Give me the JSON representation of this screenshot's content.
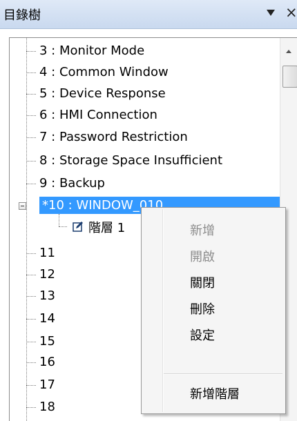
{
  "panel": {
    "title": "目錄樹",
    "pin_icon": "dropdown-arrow-icon",
    "close_icon": "close-icon",
    "close_glyph": "×"
  },
  "tree": {
    "items": [
      {
        "label": "3 : Monitor Mode"
      },
      {
        "label": "4 : Common Window"
      },
      {
        "label": "5 : Device Response"
      },
      {
        "label": "6 : HMI Connection"
      },
      {
        "label": "7 : Password Restriction"
      },
      {
        "label": "8 : Storage Space Insufficient"
      },
      {
        "label": "9 : Backup"
      },
      {
        "label": "*10 : WINDOW_010",
        "selected": true
      },
      {
        "label": "11"
      },
      {
        "label": "12"
      },
      {
        "label": "13"
      },
      {
        "label": "14"
      },
      {
        "label": "15"
      },
      {
        "label": "16"
      },
      {
        "label": "17"
      },
      {
        "label": "18"
      }
    ],
    "child": {
      "label": "階層 1",
      "icon": "edit-icon"
    }
  },
  "context_menu": {
    "items": [
      {
        "label": "新增",
        "enabled": false
      },
      {
        "label": "開啟",
        "enabled": false
      },
      {
        "label": "關閉",
        "enabled": true
      },
      {
        "label": "刪除",
        "enabled": true
      },
      {
        "label": "設定",
        "enabled": true
      },
      {
        "label": "新增階層",
        "enabled": true
      }
    ]
  },
  "colors": {
    "selection": "#3399ff",
    "titlebar": "#c9d9ef",
    "menu_bg": "#f5f5f5",
    "disabled_text": "#8d8d8d"
  }
}
